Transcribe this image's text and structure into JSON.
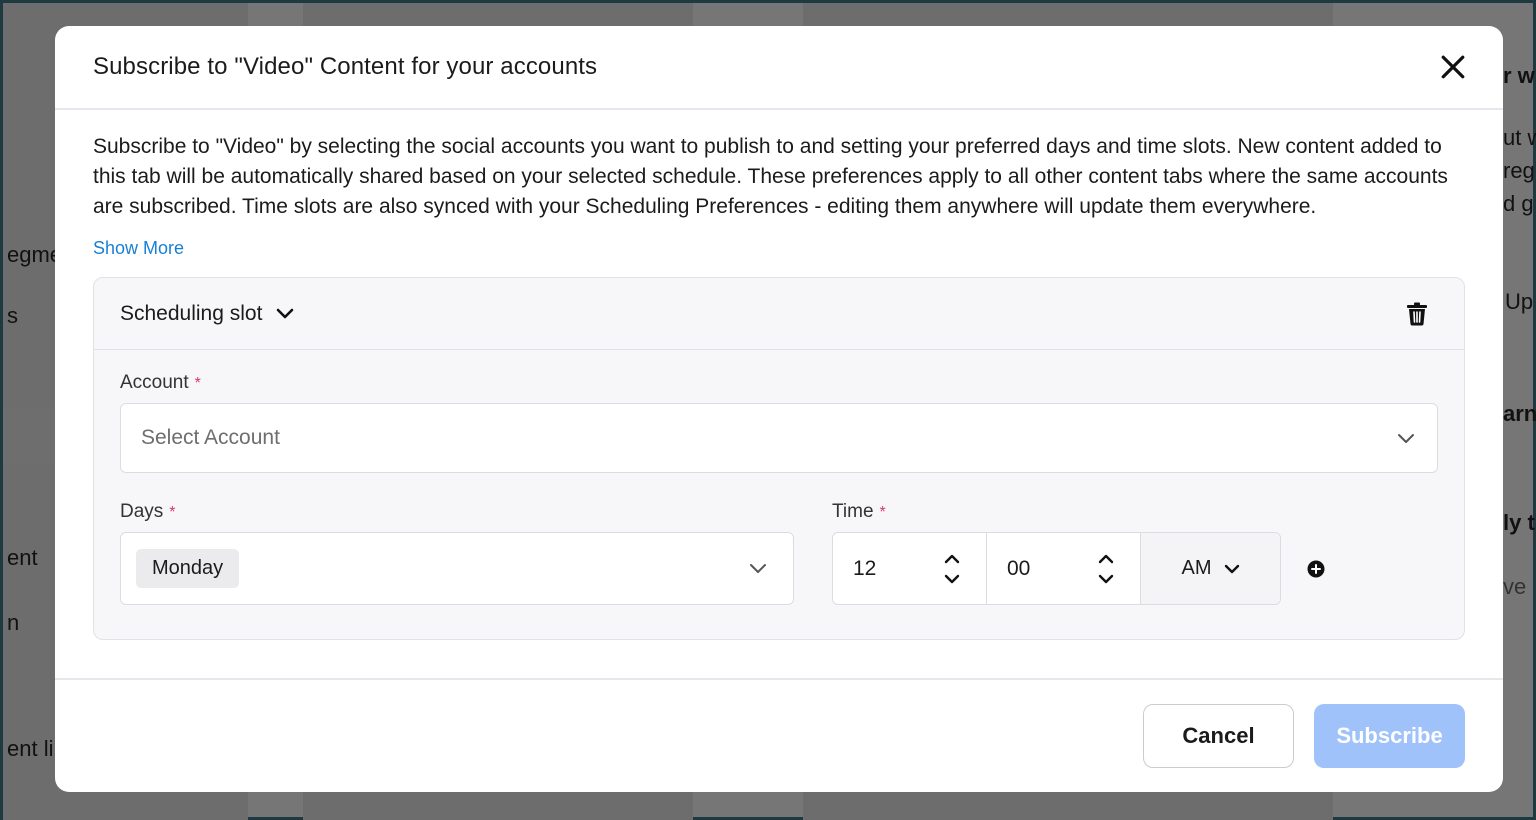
{
  "background": {
    "left_fragments": [
      "egme",
      "s",
      "ent",
      "n",
      "ent li"
    ],
    "right_fragments": [
      "r w",
      "ut w",
      "reg",
      "d g",
      "Up",
      "arn",
      "ly t",
      "ve"
    ]
  },
  "modal": {
    "title": "Subscribe to \"Video\" Content for your accounts",
    "close_icon": "close-icon",
    "description": "Subscribe to \"Video\" by selecting the social accounts you want to publish to and setting your preferred days and time slots. New content added to this tab will be automatically shared based on your selected schedule. These preferences apply to all other content tabs where the same accounts are subscribed. Time slots are also synced with your Scheduling Preferences - editing them anywhere will update them everywhere.",
    "show_more": "Show More",
    "slot": {
      "title": "Scheduling slot",
      "account_label": "Account",
      "required_mark": "*",
      "account_placeholder": "Select Account",
      "days_label": "Days",
      "days_selected": "Monday",
      "time_label": "Time",
      "hour": "12",
      "minute": "00",
      "meridiem": "AM"
    },
    "footer": {
      "cancel": "Cancel",
      "subscribe": "Subscribe"
    }
  },
  "colors": {
    "link": "#1a7fd4",
    "required": "#d43a6a",
    "subscribe_disabled": "#9fc2fb"
  }
}
